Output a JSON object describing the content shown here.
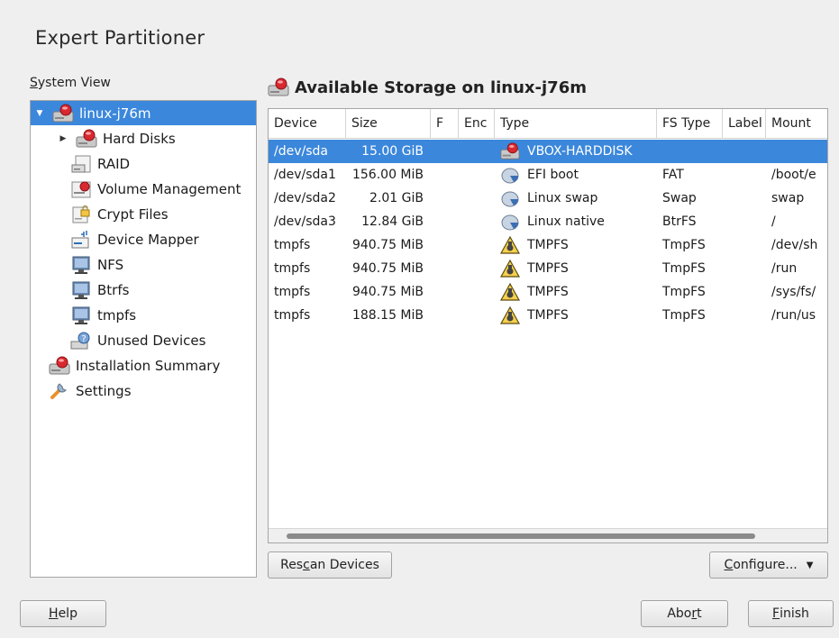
{
  "window": {
    "title": "Expert Partitioner"
  },
  "system_view": {
    "label_accel": "S",
    "label_rest": "ystem View",
    "tree": [
      {
        "label": "linux-j76m",
        "icon": "hard-disk-icon",
        "expander": "▼"
      },
      {
        "label": "Hard Disks",
        "icon": "hard-disk-icon",
        "expander": "▶"
      },
      {
        "label": "RAID",
        "icon": "raid-icon",
        "expander": ""
      },
      {
        "label": "Volume Management",
        "icon": "volume-management-icon",
        "expander": ""
      },
      {
        "label": "Crypt Files",
        "icon": "crypt-files-icon",
        "expander": ""
      },
      {
        "label": "Device Mapper",
        "icon": "device-mapper-icon",
        "expander": ""
      },
      {
        "label": "NFS",
        "icon": "nfs-icon",
        "expander": ""
      },
      {
        "label": "Btrfs",
        "icon": "btrfs-icon",
        "expander": ""
      },
      {
        "label": "tmpfs",
        "icon": "tmpfs-icon",
        "expander": ""
      },
      {
        "label": "Unused Devices",
        "icon": "unused-devices-icon",
        "expander": ""
      },
      {
        "label": "Installation Summary",
        "icon": "installation-summary-icon",
        "expander": ""
      },
      {
        "label": "Settings",
        "icon": "settings-icon",
        "expander": ""
      }
    ]
  },
  "storage": {
    "title": "Available Storage on linux-j76m",
    "columns": [
      "Device",
      "Size",
      "F",
      "Enc",
      "Type",
      "FS Type",
      "Label",
      "Mount"
    ],
    "rows": [
      {
        "device": "/dev/sda",
        "size": "15.00 GiB",
        "f": "",
        "enc": "",
        "type": "VBOX-HARDDISK",
        "type_icon": "hard-disk-icon",
        "fs_type": "",
        "label": "",
        "mount": ""
      },
      {
        "device": "/dev/sda1",
        "size": "156.00 MiB",
        "f": "",
        "enc": "",
        "type": "EFI boot",
        "type_icon": "partition-icon",
        "fs_type": "FAT",
        "label": "",
        "mount": "/boot/e"
      },
      {
        "device": "/dev/sda2",
        "size": "2.01 GiB",
        "f": "",
        "enc": "",
        "type": "Linux swap",
        "type_icon": "partition-icon",
        "fs_type": "Swap",
        "label": "",
        "mount": "swap"
      },
      {
        "device": "/dev/sda3",
        "size": "12.84 GiB",
        "f": "",
        "enc": "",
        "type": "Linux native",
        "type_icon": "partition-icon",
        "fs_type": "BtrFS",
        "label": "",
        "mount": "/"
      },
      {
        "device": "tmpfs",
        "size": "940.75 MiB",
        "f": "",
        "enc": "",
        "type": "TMPFS",
        "type_icon": "tmpfs-warning-icon",
        "fs_type": "TmpFS",
        "label": "",
        "mount": "/dev/sh"
      },
      {
        "device": "tmpfs",
        "size": "940.75 MiB",
        "f": "",
        "enc": "",
        "type": "TMPFS",
        "type_icon": "tmpfs-warning-icon",
        "fs_type": "TmpFS",
        "label": "",
        "mount": "/run"
      },
      {
        "device": "tmpfs",
        "size": "940.75 MiB",
        "f": "",
        "enc": "",
        "type": "TMPFS",
        "type_icon": "tmpfs-warning-icon",
        "fs_type": "TmpFS",
        "label": "",
        "mount": "/sys/fs/"
      },
      {
        "device": "tmpfs",
        "size": "188.15 MiB",
        "f": "",
        "enc": "",
        "type": "TMPFS",
        "type_icon": "tmpfs-warning-icon",
        "fs_type": "TmpFS",
        "label": "",
        "mount": "/run/us"
      }
    ],
    "selected_row": 0
  },
  "buttons": {
    "rescan_pre": "Res",
    "rescan_accel": "c",
    "rescan_post": "an Devices",
    "configure_pre": "",
    "configure_accel": "C",
    "configure_post": "onfigure...",
    "help_pre": "",
    "help_accel": "H",
    "help_post": "elp",
    "abort_pre": "Abo",
    "abort_accel": "r",
    "abort_post": "t",
    "finish_pre": "",
    "finish_accel": "F",
    "finish_post": "inish"
  },
  "colors": {
    "selection": "#3b87dc",
    "background": "#efefef"
  }
}
